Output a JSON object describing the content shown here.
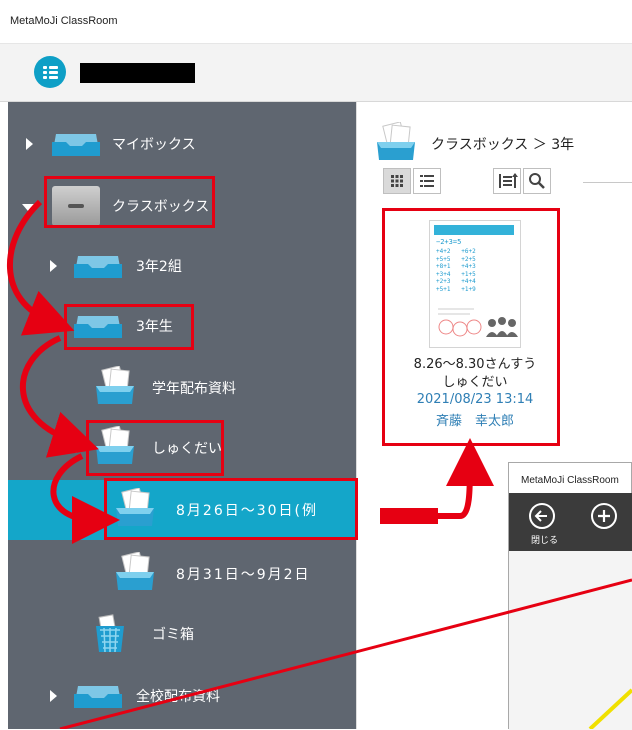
{
  "app": {
    "window_title": "MetaMoJi ClassRoom"
  },
  "sidebar": {
    "items": [
      {
        "label": "マイボックス"
      },
      {
        "label": "クラスボックス"
      },
      {
        "label": "3年2組"
      },
      {
        "label": "3年生"
      },
      {
        "label": "学年配布資料"
      },
      {
        "label": "しゅくだい"
      },
      {
        "label": "8月26日〜30日(例"
      },
      {
        "label": "8月31日〜9月2日"
      },
      {
        "label": "ゴミ箱"
      },
      {
        "label": "全校配布資料"
      }
    ]
  },
  "content": {
    "breadcrumb": "クラスボックス ＞ 3年",
    "card": {
      "name_line1": "8.26〜8.30さんすう",
      "name_line2": "しゅくだい",
      "date": "2021/08/23 13:14",
      "owner": "斉藤　幸太郎",
      "thumbnail_math": [
        "−2+3=5",
        "+4+2",
        "+6+2",
        "+5+5",
        "+2+5",
        "+8+1",
        "+4+3",
        "+3+4",
        "+1+5",
        "+2+3",
        "+4+4",
        "+5+1",
        "+1+9"
      ]
    }
  },
  "doc_window": {
    "title": "MetaMoJi ClassRoom",
    "close_label": "閉じる"
  },
  "colors": {
    "accent": "#14a6c9",
    "sidebar_bg": "#5f6670",
    "highlight": "#e60012",
    "meta_text": "#2f7fb5"
  }
}
